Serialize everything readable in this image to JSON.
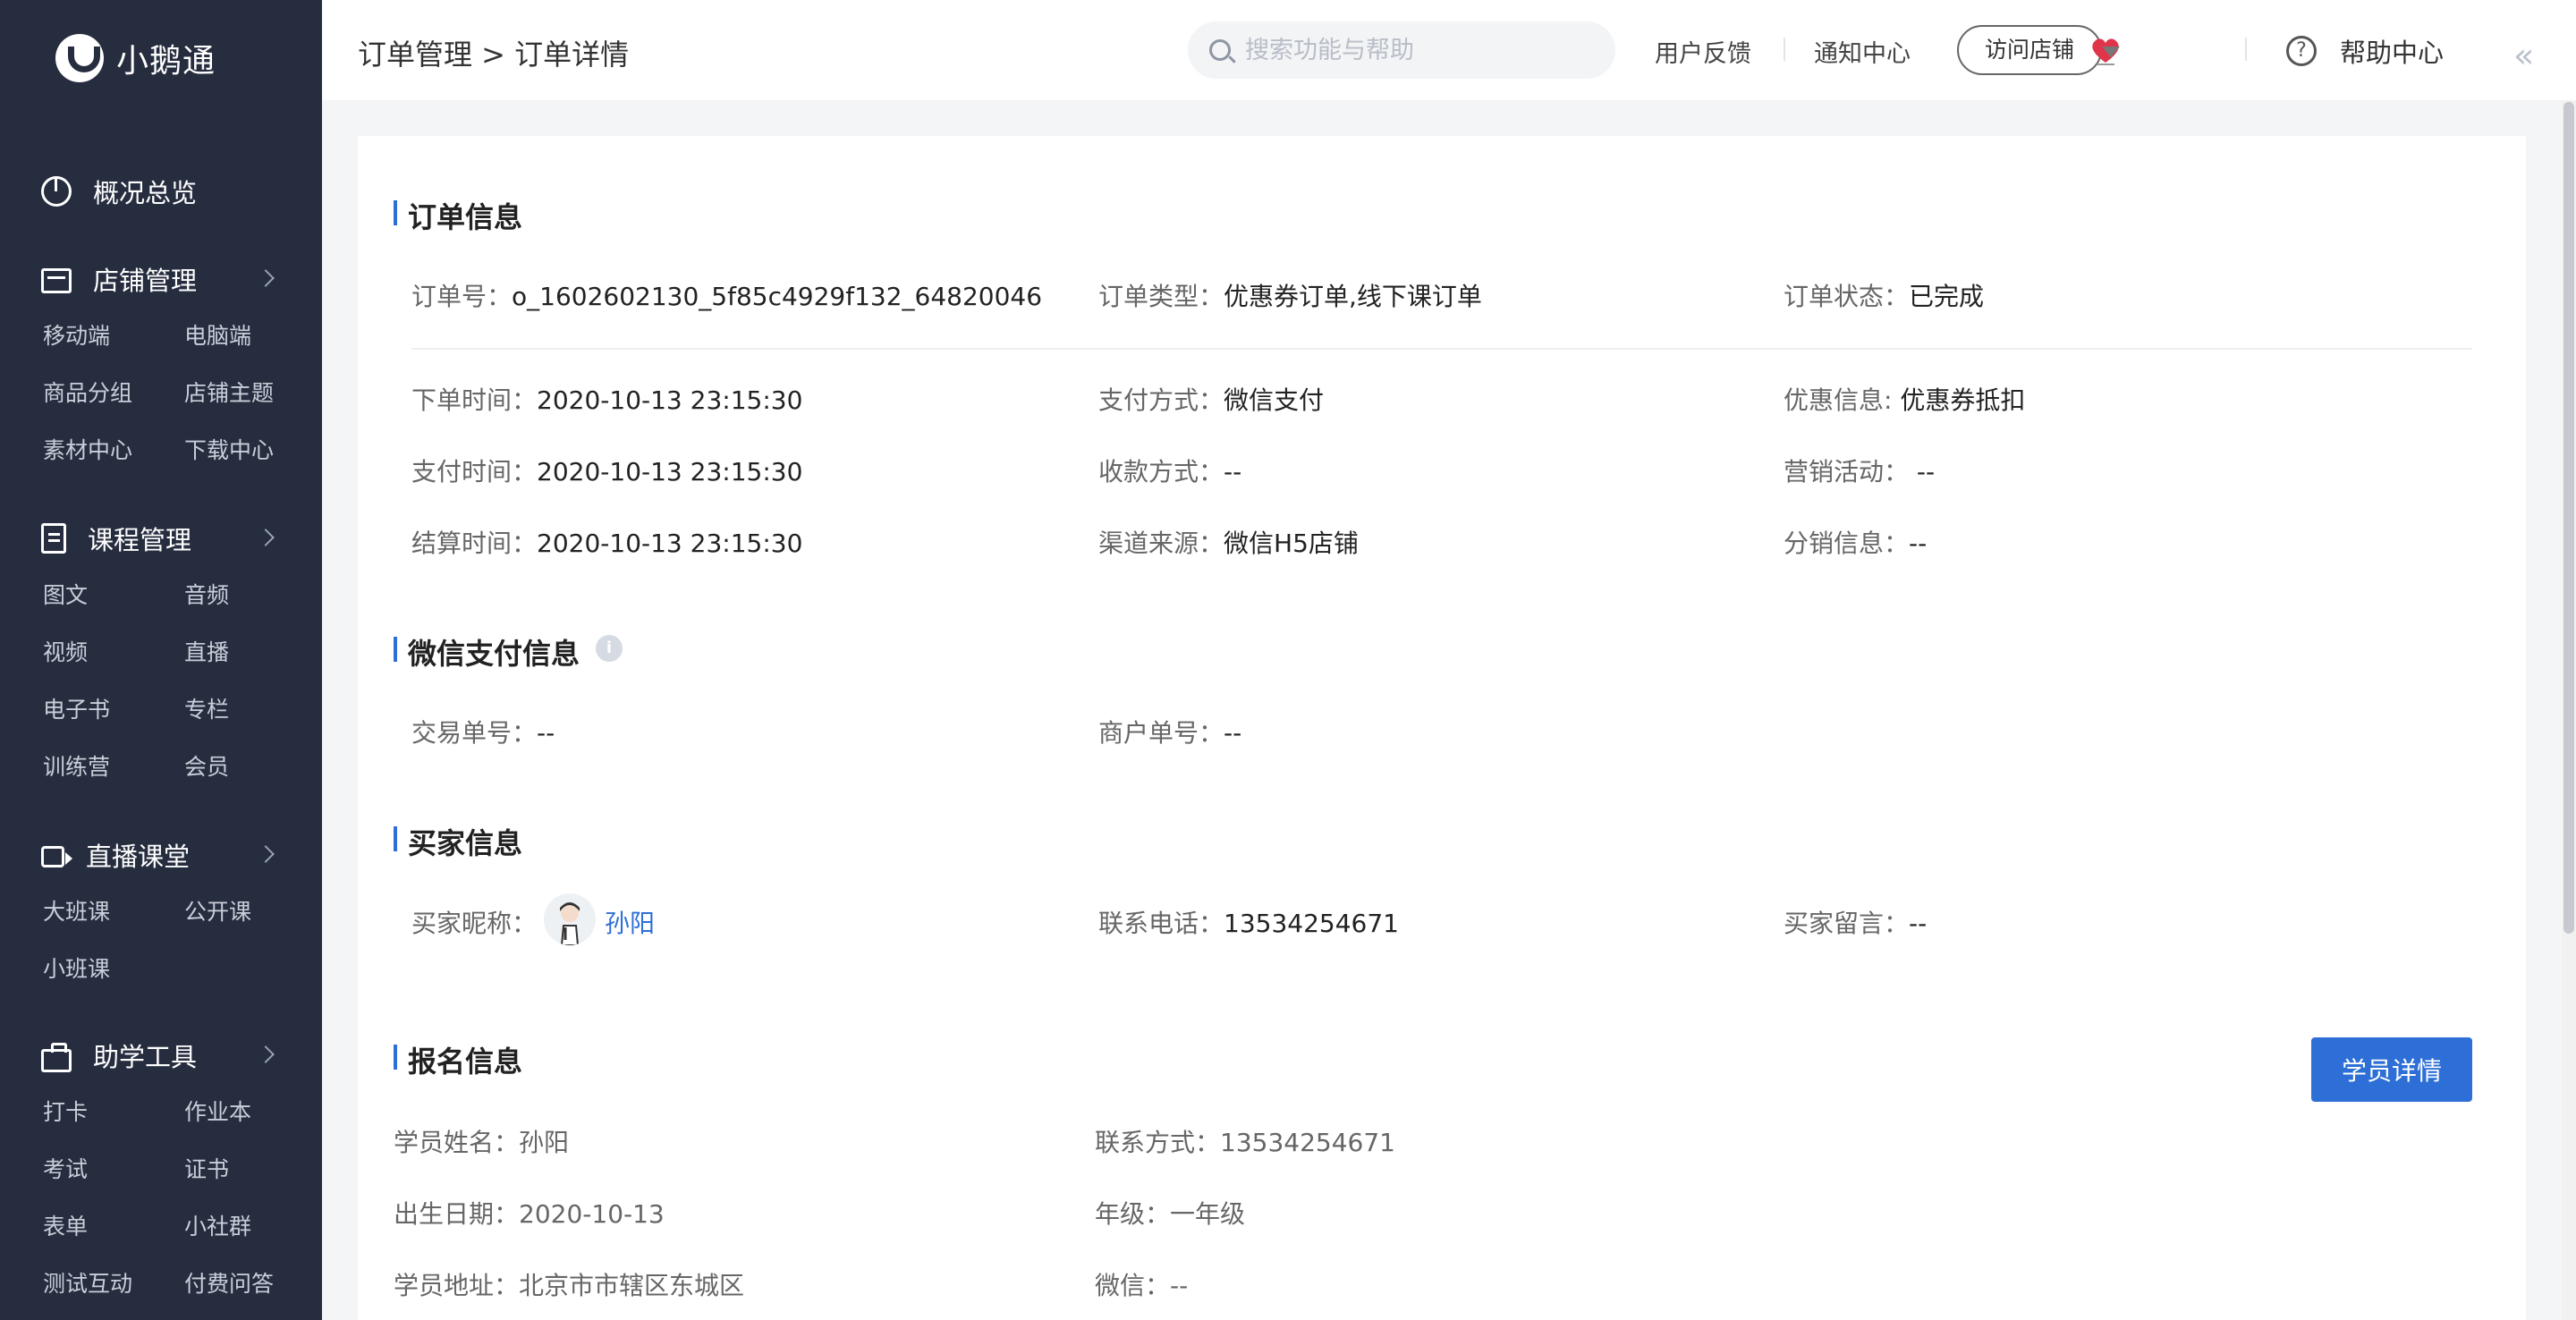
{
  "app": {
    "name": "小鹅通"
  },
  "sidebar": {
    "groups": [
      {
        "label": "概况总览",
        "icon": "pie-chart-icon",
        "items": []
      },
      {
        "label": "店铺管理",
        "icon": "store-icon",
        "items": [
          "移动端",
          "电脑端",
          "商品分组",
          "店铺主题",
          "素材中心",
          "下载中心"
        ]
      },
      {
        "label": "课程管理",
        "icon": "course-book-icon",
        "items": [
          "图文",
          "音频",
          "视频",
          "直播",
          "电子书",
          "专栏",
          "训练营",
          "会员"
        ]
      },
      {
        "label": "直播课堂",
        "icon": "video-camera-icon",
        "items": [
          "大班课",
          "公开课",
          "小班课"
        ]
      },
      {
        "label": "助学工具",
        "icon": "toolbox-icon",
        "items": [
          "打卡",
          "作业本",
          "考试",
          "证书",
          "表单",
          "小社群",
          "测试互动",
          "付费问答"
        ]
      }
    ]
  },
  "header": {
    "breadcrumb": "订单管理 > 订单详情",
    "search_placeholder": "搜索功能与帮助",
    "feedback": "用户反馈",
    "notifications": "通知中心",
    "visit_store": "访问店铺",
    "help": "帮助中心",
    "collapse": "«"
  },
  "order_info": {
    "title": "订单信息",
    "order_no_label": "订单号：",
    "order_no": "o_1602602130_5f85c4929f132_64820046",
    "type_label": "订单类型：",
    "type": "优惠券订单,线下课订单",
    "status_label": "订单状态：",
    "status": "已完成",
    "order_time_label": "下单时间：",
    "order_time": "2020-10-13 23:15:30",
    "pay_method_label": "支付方式：",
    "pay_method": "微信支付",
    "discount_label": "优惠信息: ",
    "discount": "优惠券抵扣",
    "pay_time_label": "支付时间：",
    "pay_time": "2020-10-13 23:15:30",
    "collect_label": "收款方式：",
    "collect": "--",
    "marketing_label": "营销活动： ",
    "marketing": "--",
    "settle_time_label": "结算时间：",
    "settle_time": "2020-10-13 23:15:30",
    "channel_label": "渠道来源：",
    "channel": "微信H5店铺",
    "distribution_label": "分销信息：",
    "distribution": "--"
  },
  "wechat_pay": {
    "title": "微信支付信息",
    "trade_no_label": "交易单号：",
    "trade_no": "--",
    "merchant_no_label": "商户单号：",
    "merchant_no": "--"
  },
  "buyer": {
    "title": "买家信息",
    "nickname_label": "买家昵称：",
    "nickname": "孙阳",
    "phone_label": "联系电话：",
    "phone": "13534254671",
    "message_label": "买家留言：",
    "message": "--"
  },
  "signup": {
    "title": "报名信息",
    "detail_button": "学员详情",
    "name_label": "学员姓名：",
    "name": "孙阳",
    "contact_label": "联系方式：",
    "contact": "13534254671",
    "birth_label": "出生日期：",
    "birth": "2020-10-13",
    "grade_label": "年级：",
    "grade": "一年级",
    "address_label": "学员地址：",
    "address": "北京市市辖区东城区",
    "wechat_label": "微信：",
    "wechat": "--"
  },
  "colors": {
    "sidebar": "#262d3f",
    "accent": "#2d6fd6"
  }
}
